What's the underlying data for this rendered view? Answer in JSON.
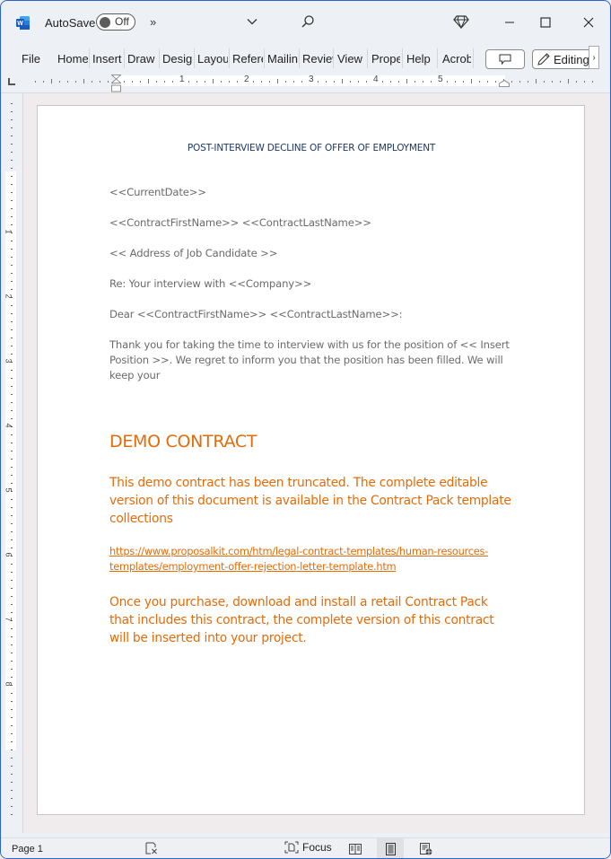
{
  "titlebar": {
    "app_icon": "word-icon",
    "autosave_label": "AutoSave",
    "autosave_state": "Off",
    "more_commands": "»",
    "icons": [
      "chevron-down-icon",
      "search-icon",
      "diamond-icon",
      "minimize-icon",
      "maximize-icon",
      "close-icon"
    ]
  },
  "ribbon": {
    "tabs": [
      {
        "label": "File"
      },
      {
        "label": "Home"
      },
      {
        "label": "Insert"
      },
      {
        "label": "Draw"
      },
      {
        "label": "Design"
      },
      {
        "label": "Layout"
      },
      {
        "label": "References"
      },
      {
        "label": "Mailings"
      },
      {
        "label": "Review"
      },
      {
        "label": "View"
      },
      {
        "label": "Properties"
      },
      {
        "label": "Help"
      },
      {
        "label": "Acrobat"
      }
    ],
    "comments_icon": "comment-icon",
    "editing_label": "Editing",
    "scroll_label": "›"
  },
  "ruler": {
    "horizontal_numbers": [
      "1",
      "2",
      "3",
      "4",
      "5"
    ],
    "vertical_numbers": [
      "1",
      "2",
      "3",
      "4",
      "5",
      "6",
      "7",
      "8"
    ]
  },
  "document": {
    "title": "POST-INTERVIEW DECLINE OF OFFER OF EMPLOYMENT",
    "paragraphs": [
      "<<CurrentDate>>",
      "<<ContractFirstName>> <<ContractLastName>>",
      "<< Address of Job Candidate >>",
      "Re: Your interview with <<Company>>",
      "Dear <<ContractFirstName>> <<ContractLastName>>:",
      "Thank you for taking the time to interview with us for the position of << Insert Position >>. We regret to inform you that the position has been filled. We will keep your"
    ],
    "demo_heading": "DEMO CONTRACT",
    "demo_notice": "This demo contract has been truncated. The complete editable version of this document is available in the Contract Pack template collections",
    "demo_link": "https://www.proposalkit.com/htm/legal-contract-templates/human-resources-templates/employment-offer-rejection-letter-template.htm",
    "demo_footer": "Once you purchase, download and install a retail Contract Pack that includes this contract, the complete version of this contract will be inserted into your project.",
    "accent_color": "#e36c0a",
    "title_color": "#1f3864"
  },
  "statusbar": {
    "page_label": "Page 1",
    "focus_label": "Focus",
    "active_view": "Print Layout"
  }
}
